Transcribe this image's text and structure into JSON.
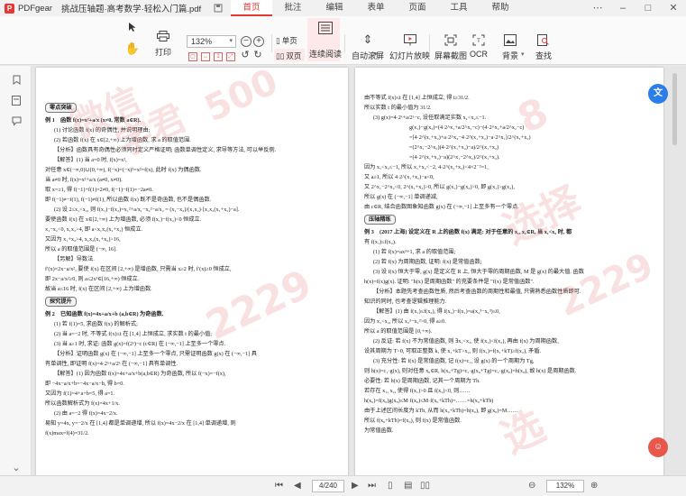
{
  "app": {
    "name": "PDFgear",
    "doc_title": "挑战压轴题·高考数学·轻松入门篇.pdf"
  },
  "menu_tabs": [
    "首页",
    "批注",
    "编辑",
    "表单",
    "页面",
    "工具",
    "帮助"
  ],
  "active_tab": "首页",
  "toolbar": {
    "print": "打印",
    "zoom_value": "132%",
    "single_page": "单页",
    "double_page": "双页",
    "continuous_read": "连续阅读",
    "auto_scroll": "自动滚屏",
    "slideshow": "幻灯片放映",
    "screenshot": "屏幕截图",
    "ocr": "OCR",
    "background": "背景",
    "search": "查找"
  },
  "status": {
    "page_current": "4",
    "page_total": "/240",
    "zoom": "132%"
  },
  "colors": {
    "accent": "#e53935",
    "float_blue": "#2b7de9",
    "float_red": "#e8574c"
  },
  "left_page": {
    "tags": [
      "零点突破",
      "探究提升"
    ],
    "lines": [
      "例 1　函数 f(x)=x²+a/x (x≠0, 常数 a∈R).",
      "(1) 讨论函数 f(x) 的奇偶性, 并说明理由;",
      "(2) 若函数 f(x) 在 x∈[2,+∞) 上为增函数, 求 a 的取值范围.",
      "【分析】函数具有奇偶性必须同时定义严格证明; 函数单调性定义, 求导等方法, 可以举反例.",
      "【解答】(1) 当 a=0 时, f(x)=x²,",
      "对任意 x∈(−∞,0)∪(0,+∞), f(−x)=(−x)²=x²=f(x), 此时 f(x) 为偶函数.",
      "当 a≠0 时, f(x)=x²+a/x (a≠0, x≠0).",
      "取 x=±1, 得 f(−1)+f(1)=2≠0, f(−1)−f(1)=−2a≠0.",
      "即 f(−1)≠−f(1), f(−1)≠f(1), 所以函数 f(x) 既不是奇函数, 也不是偶函数.",
      "(2) 设 2≤x₁<x₂, 则 f(x₁)−f(x₂)=x₁²+a/x₁−x₂²−a/x₂ = (x₁−x₂)/(x₁x₂)·[x₁x₂(x₁+x₂)−a].",
      "要使函数 f(x) 在 x∈[2,+∞) 上为增函数, 必须 f(x₁)−f(x₂)<0 恒成立.",
      "x₁−x₂<0, x₁x₂>4, 即 a<x₁x₂(x₁+x₂) 恒成立.",
      "又因为 x₁+x₂>4, x₁x₂(x₁+x₂)>16,",
      "所以 a 的取值范围是 (−∞, 16].",
      "【另解】导数法.",
      "f′(x)=2x−a/x², 要使 f(x) 在区间 [2,+∞) 是增函数, 只需当 x≥2 时, f′(x)≥0 恒成立,",
      "即 2x−a/x²≥0, 则 a≤2x³∈[16,+∞) 恒成立.",
      "故当 a≤16 时, f(x) 在区间 [2,+∞) 上为增函数.",
      "例 2　已知函数 f(x)=4x+a/x+b (a,b∈R) 为奇函数.",
      "(1) 若 f(1)=5, 求函数 f(x) 的解析式;",
      "(2) 当 a=−2 时, 不等式 f(x)≤t 在 [1,4] 上恒成立, 求实数 t 的最小值;",
      "(3) 当 a≥1 时, 求证: 函数 g(x)=f(2ˣ)−c (c∈R) 在 (−∞,−1] 上至多一个零点.",
      "【分析】证明函数 g(x) 在 (−∞,−1] 上至多一个零点, 只需证明函数 g(x) 在 (−∞,−1] 具",
      "有单调性, 即证明 f(x)=4·2ˣ+a/2ˣ 在 (−∞,−1] 具有单调性.",
      "【解答】(1) 因为函数 f(x)=4x+a/x+b(a,b∈R) 为奇函数, 所以 f(−x)=−f(x),",
      "即 −4x−a/x+b=−4x−a/x−b, 得 b=0.",
      "又因为 f(1)=4+a+b=5, 得 a=1.",
      "所以函数解析式为 f(x)=4x+1/x.",
      "(2) 由 a=−2 得 f(x)=4x−2/x.",
      "易知 y=4x, y=−2/x 在 [1,4] 都是单调递增, 所以 f(x)=4x−2/x 在 [1,4] 单调递增, 则",
      "f(x)max=f(4)=31/2."
    ]
  },
  "right_page": {
    "tags": [
      "压轴精练"
    ],
    "lines": [
      "由不等式 f(x)≤t 在 [1,4] 上恒成立, 得 t≥31/2.",
      "所以实数 t 的最小值为 31/2.",
      "(3) g(x)=4·2ˣ+a/2ˣ−c, 设任取满足实数 x₁<x₂≤−1.",
      "g(x₁)−g(x₂)=(4·2^x₁+a/2^x₁−c)−(4·2^x₂+a/2^x₂−c)",
      "=[4·2^(x₁+x₂)+a·2^x₂−4·2^(x₁+x₂)−a·2^x₁]/2^(x₁+x₂)",
      "=(2^x₁−2^x₂)(4·2^(x₁+x₂)−a)/2^(x₁+x₂)",
      "=(4·2^(x₁+x₂)−a)(2^x₁−2^x₂)/2^(x₁+x₂).",
      "因为 x₁<x₂≤−1, 所以 x₁+x₂<−2, 4·2^(x₁+x₂)<4×2⁻²=1,",
      "又 a≥1, 所以 4·2^(x₁+x₂)−a<0,",
      "又 2^x₁−2^x₂<0, 2^(x₁+x₂)>0, 所以 g(x₁)−g(x₂)>0, 即 g(x₁)>g(x₂),",
      "所以 g(x) 在 (−∞,−1] 单调递减,",
      "由 c∈R, 结合函数图象知函数 g(x) 在 (−∞,−1] 上至多有一个零点.",
      "例 3　(2017 上海) 设定义在 R 上的函数 f(x) 满足: 对于任意的 x₁, x₂∈R, 当 x₁<x₂ 时, 都",
      "有 f(x₁)≤f(x₂).",
      "(1) 若 f(x)=ax³+1, 求 a 的取值范围;",
      "(2) 若 f(x) 为周期函数, 证明: f(x) 是常值函数;",
      "(3) 设 f(x) 恒大于零, g(x) 是定义在 R 上, 恒大于零的周期函数, M 是 g(x) 的最大值. 函数",
      "h(x)=f(x)g(x). 证明: \"h(x) 是周期函数\" 的充要条件是 \"f(x) 是常值函数\".",
      "【分析】本题先考查函数性质, 然后考查函数的周期性和最值, 只需熟悉函数性质即可.",
      "知识的同时, 也考查逻辑推理能力.",
      "【解答】(1) 由 f(x₁)≤f(x₂), 得 f(x₂)−f(x₁)=a(x₂³−x₁³)≤0,",
      "因为 x₁<x₂, 所以 x₂³−x₁³>0, 得 a≥0.",
      "所以 a 的取值范围是 [0,+∞).",
      "(2) 反证: 若 f(x) 不为常值函数, 则 ∃x₁<x₂, 使 f(x₁)<f(x₂), 再由 f(x) 为周期函数,",
      "设其周期为 T>0, 可取正整数 k, 使 x₁+kT>x₂, 则 f(x₁)=f(x₁+kT)≥f(x₂), 矛盾.",
      "(3) 充分性: 若 f(x) 是常值函数, 记 f(x)=c₁, 设 g(x) 的一个周期为 Tg,",
      "则 h(x)=c₁·g(x), 则对任意 x₀∈R, h(x₀+Tg)=c₁·g(x₀+Tg)=c₁·g(x₀)=h(x₀), 故 h(x) 是周期函数.",
      "必要性: 若 h(x) 是周期函数, 记其一个周期为 Th.",
      "若存在 x₁, x₂, 使得 f(x₁)>0 且 f(x₂)<0, 则……",
      "h(x₀)=f(x₀)g(x₀)≤M·f(x₀)≤M·f(x₀+kTh)=……=h(x₀+kTh)",
      "由于上述区间长度为 kTh, 从而 h(x₀+kTh)=h(x₀), 即 g(x₀)=M……",
      "所以 f(x₀+kTh)=f(x₀), 则 f(x) 是常值函数.",
      "为常值函数."
    ]
  },
  "watermarks": [
    "微信",
    "学君",
    "选择",
    "500",
    "8",
    "2229",
    "选",
    "2229"
  ]
}
